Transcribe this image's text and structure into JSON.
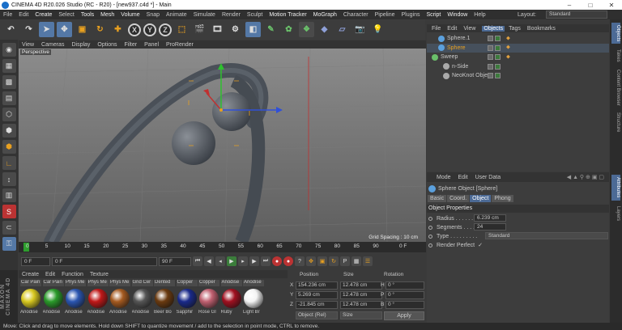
{
  "window": {
    "title": "CINEMA 4D R20.026 Studio (RC - R20) - [new937.c4d *] - Main",
    "min": "–",
    "max": "□",
    "close": "✕"
  },
  "menu": [
    "File",
    "Edit",
    "Create",
    "Select",
    "Tools",
    "Mesh",
    "Volume",
    "Snap",
    "Animate",
    "Simulate",
    "Render",
    "Sculpt",
    "Motion Tracker",
    "MoGraph",
    "Character",
    "Pipeline",
    "Plugins",
    "Script",
    "Window",
    "Help"
  ],
  "layout": {
    "label": "Layout:",
    "value": "Standard"
  },
  "viewport": {
    "menu": [
      "View",
      "Cameras",
      "Display",
      "Options",
      "Filter",
      "Panel",
      "ProRender"
    ],
    "camera": "Perspective",
    "grid_spacing": "Grid Spacing : 10 cm"
  },
  "timeline": {
    "ticks": [
      "0",
      "5",
      "10",
      "15",
      "20",
      "25",
      "30",
      "35",
      "40",
      "45",
      "50",
      "55",
      "60",
      "65",
      "70",
      "75",
      "80",
      "85",
      "90"
    ],
    "end_frame": "0 F",
    "current": "0 F",
    "start": "0 F",
    "range_end": "90 F",
    "max": "90 F"
  },
  "material_manager": {
    "menu": [
      "Create",
      "Edit",
      "Function",
      "Texture"
    ],
    "materials": [
      {
        "label": "Car Pain",
        "name": "Anodise",
        "color": "#d8c820"
      },
      {
        "label": "Car Pain",
        "name": "Anodise",
        "color": "#2a9a2a"
      },
      {
        "label": "Phys Me",
        "name": "Anodise",
        "color": "#2a55b0"
      },
      {
        "label": "Phys Me",
        "name": "Anodise",
        "color": "#c01818"
      },
      {
        "label": "Phys Me",
        "name": "Anodise",
        "color": "#a55a20"
      },
      {
        "label": "Grid Cer",
        "name": "Anodise",
        "color": "#555"
      },
      {
        "label": "Dented",
        "name": "Beer Bo",
        "color": "#6a3a10"
      },
      {
        "label": "Copper",
        "name": "Sapphir",
        "color": "#1a2a8a"
      },
      {
        "label": "Copper",
        "name": "Rose Gl",
        "color": "#c06070"
      },
      {
        "label": "Anodise",
        "name": "Ruby",
        "color": "#a01020"
      },
      {
        "label": "Anodise",
        "name": "Light Br",
        "color": "#f4f4f4"
      }
    ],
    "brand": "MAXON CINEMA 4D"
  },
  "coords": {
    "headers": [
      "Position",
      "Size",
      "Rotation"
    ],
    "rows": [
      {
        "axis": "X",
        "pos": "154.236 cm",
        "size": "12.478 cm",
        "rot_axis": "H",
        "rot": "0 °"
      },
      {
        "axis": "Y",
        "pos": "5.269 cm",
        "size": "12.478 cm",
        "rot_axis": "P",
        "rot": "0 °"
      },
      {
        "axis": "Z",
        "pos": "-21.845 cm",
        "size": "12.478 cm",
        "rot_axis": "B",
        "rot": "0 °"
      }
    ],
    "mode": "Object (Rel)",
    "size_mode": "Size",
    "apply": "Apply"
  },
  "object_manager": {
    "menu": [
      "File",
      "Edit",
      "View",
      "Objects",
      "Tags",
      "Bookmarks"
    ],
    "active_tab": "Objects",
    "objects": [
      {
        "name": "Sphere.1",
        "icon_color": "#5ba0dd",
        "selected": false
      },
      {
        "name": "Sphere",
        "icon_color": "#5ba0dd",
        "selected": true
      },
      {
        "name": "Sweep",
        "icon_color": "#6ac06a",
        "selected": false
      },
      {
        "name": "n-Side",
        "icon_color": "#aaa",
        "selected": false
      },
      {
        "name": "NeoKnot Object",
        "icon_color": "#aaa",
        "selected": false
      }
    ]
  },
  "attributes": {
    "menu": [
      "Mode",
      "Edit",
      "User Data"
    ],
    "title": "Sphere Object [Sphere]",
    "tabs": [
      "Basic",
      "Coord.",
      "Object",
      "Phong"
    ],
    "active_tab": "Object",
    "section": "Object Properties",
    "props": [
      {
        "label": "Radius . . . . . . .",
        "value": "6.239 cm"
      },
      {
        "label": "Segments . . . .",
        "value": "24"
      },
      {
        "label": "Type . . . . . . . . .",
        "value": "Standard"
      },
      {
        "label": "Render Perfect",
        "value": "✓"
      }
    ]
  },
  "right_tabs": [
    "Objects",
    "Takes",
    "Content Browser",
    "Structure",
    "Attributes",
    "Layers"
  ],
  "status": "Move: Click and drag to move elements. Hold down SHIFT to quantize movement / add to the selection in point mode, CTRL to remove."
}
